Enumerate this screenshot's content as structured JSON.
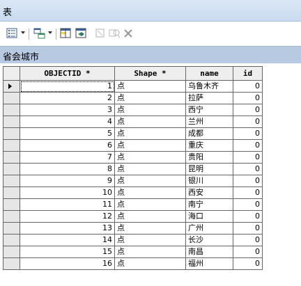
{
  "window": {
    "title": "表"
  },
  "toolbar": {
    "icons": [
      "table-options-icon",
      "related-tables-icon",
      "select-by-attributes-icon",
      "switch-selection-icon",
      "clear-selection-icon",
      "zoom-to-selected-icon",
      "delete-selected-icon"
    ]
  },
  "tab": {
    "label": "省会城市"
  },
  "table": {
    "columns": [
      "OBJECTID *",
      "Shape *",
      "name",
      "id"
    ],
    "rows": [
      {
        "objectid": "1",
        "shape": "点",
        "name": "乌鲁木齐",
        "id": "0"
      },
      {
        "objectid": "2",
        "shape": "点",
        "name": "拉萨",
        "id": "0"
      },
      {
        "objectid": "3",
        "shape": "点",
        "name": "西宁",
        "id": "0"
      },
      {
        "objectid": "4",
        "shape": "点",
        "name": "兰州",
        "id": "0"
      },
      {
        "objectid": "5",
        "shape": "点",
        "name": "成都",
        "id": "0"
      },
      {
        "objectid": "6",
        "shape": "点",
        "name": "重庆",
        "id": "0"
      },
      {
        "objectid": "7",
        "shape": "点",
        "name": "贵阳",
        "id": "0"
      },
      {
        "objectid": "8",
        "shape": "点",
        "name": "昆明",
        "id": "0"
      },
      {
        "objectid": "9",
        "shape": "点",
        "name": "银川",
        "id": "0"
      },
      {
        "objectid": "10",
        "shape": "点",
        "name": "西安",
        "id": "0"
      },
      {
        "objectid": "11",
        "shape": "点",
        "name": "南宁",
        "id": "0"
      },
      {
        "objectid": "12",
        "shape": "点",
        "name": "海口",
        "id": "0"
      },
      {
        "objectid": "13",
        "shape": "点",
        "name": "广州",
        "id": "0"
      },
      {
        "objectid": "14",
        "shape": "点",
        "name": "长沙",
        "id": "0"
      },
      {
        "objectid": "15",
        "shape": "点",
        "name": "南昌",
        "id": "0"
      },
      {
        "objectid": "16",
        "shape": "点",
        "name": "福州",
        "id": "0"
      }
    ]
  },
  "colors": {
    "titlebar": "#c9dbf1",
    "tabbar": "#b8c9e2",
    "gridline": "#646464"
  }
}
